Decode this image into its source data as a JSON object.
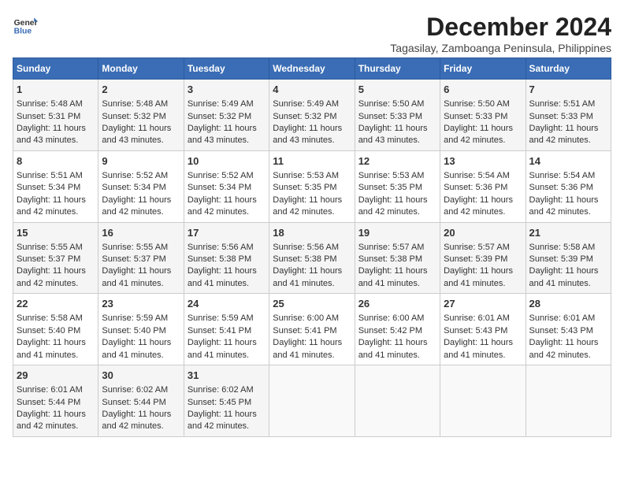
{
  "header": {
    "logo_line1": "General",
    "logo_line2": "Blue",
    "title": "December 2024",
    "subtitle": "Tagasilay, Zamboanga Peninsula, Philippines"
  },
  "days_of_week": [
    "Sunday",
    "Monday",
    "Tuesday",
    "Wednesday",
    "Thursday",
    "Friday",
    "Saturday"
  ],
  "weeks": [
    [
      {
        "day": "1",
        "lines": [
          "Sunrise: 5:48 AM",
          "Sunset: 5:31 PM",
          "Daylight: 11 hours",
          "and 43 minutes."
        ]
      },
      {
        "day": "2",
        "lines": [
          "Sunrise: 5:48 AM",
          "Sunset: 5:32 PM",
          "Daylight: 11 hours",
          "and 43 minutes."
        ]
      },
      {
        "day": "3",
        "lines": [
          "Sunrise: 5:49 AM",
          "Sunset: 5:32 PM",
          "Daylight: 11 hours",
          "and 43 minutes."
        ]
      },
      {
        "day": "4",
        "lines": [
          "Sunrise: 5:49 AM",
          "Sunset: 5:32 PM",
          "Daylight: 11 hours",
          "and 43 minutes."
        ]
      },
      {
        "day": "5",
        "lines": [
          "Sunrise: 5:50 AM",
          "Sunset: 5:33 PM",
          "Daylight: 11 hours",
          "and 43 minutes."
        ]
      },
      {
        "day": "6",
        "lines": [
          "Sunrise: 5:50 AM",
          "Sunset: 5:33 PM",
          "Daylight: 11 hours",
          "and 42 minutes."
        ]
      },
      {
        "day": "7",
        "lines": [
          "Sunrise: 5:51 AM",
          "Sunset: 5:33 PM",
          "Daylight: 11 hours",
          "and 42 minutes."
        ]
      }
    ],
    [
      {
        "day": "8",
        "lines": [
          "Sunrise: 5:51 AM",
          "Sunset: 5:34 PM",
          "Daylight: 11 hours",
          "and 42 minutes."
        ]
      },
      {
        "day": "9",
        "lines": [
          "Sunrise: 5:52 AM",
          "Sunset: 5:34 PM",
          "Daylight: 11 hours",
          "and 42 minutes."
        ]
      },
      {
        "day": "10",
        "lines": [
          "Sunrise: 5:52 AM",
          "Sunset: 5:34 PM",
          "Daylight: 11 hours",
          "and 42 minutes."
        ]
      },
      {
        "day": "11",
        "lines": [
          "Sunrise: 5:53 AM",
          "Sunset: 5:35 PM",
          "Daylight: 11 hours",
          "and 42 minutes."
        ]
      },
      {
        "day": "12",
        "lines": [
          "Sunrise: 5:53 AM",
          "Sunset: 5:35 PM",
          "Daylight: 11 hours",
          "and 42 minutes."
        ]
      },
      {
        "day": "13",
        "lines": [
          "Sunrise: 5:54 AM",
          "Sunset: 5:36 PM",
          "Daylight: 11 hours",
          "and 42 minutes."
        ]
      },
      {
        "day": "14",
        "lines": [
          "Sunrise: 5:54 AM",
          "Sunset: 5:36 PM",
          "Daylight: 11 hours",
          "and 42 minutes."
        ]
      }
    ],
    [
      {
        "day": "15",
        "lines": [
          "Sunrise: 5:55 AM",
          "Sunset: 5:37 PM",
          "Daylight: 11 hours",
          "and 42 minutes."
        ]
      },
      {
        "day": "16",
        "lines": [
          "Sunrise: 5:55 AM",
          "Sunset: 5:37 PM",
          "Daylight: 11 hours",
          "and 41 minutes."
        ]
      },
      {
        "day": "17",
        "lines": [
          "Sunrise: 5:56 AM",
          "Sunset: 5:38 PM",
          "Daylight: 11 hours",
          "and 41 minutes."
        ]
      },
      {
        "day": "18",
        "lines": [
          "Sunrise: 5:56 AM",
          "Sunset: 5:38 PM",
          "Daylight: 11 hours",
          "and 41 minutes."
        ]
      },
      {
        "day": "19",
        "lines": [
          "Sunrise: 5:57 AM",
          "Sunset: 5:38 PM",
          "Daylight: 11 hours",
          "and 41 minutes."
        ]
      },
      {
        "day": "20",
        "lines": [
          "Sunrise: 5:57 AM",
          "Sunset: 5:39 PM",
          "Daylight: 11 hours",
          "and 41 minutes."
        ]
      },
      {
        "day": "21",
        "lines": [
          "Sunrise: 5:58 AM",
          "Sunset: 5:39 PM",
          "Daylight: 11 hours",
          "and 41 minutes."
        ]
      }
    ],
    [
      {
        "day": "22",
        "lines": [
          "Sunrise: 5:58 AM",
          "Sunset: 5:40 PM",
          "Daylight: 11 hours",
          "and 41 minutes."
        ]
      },
      {
        "day": "23",
        "lines": [
          "Sunrise: 5:59 AM",
          "Sunset: 5:40 PM",
          "Daylight: 11 hours",
          "and 41 minutes."
        ]
      },
      {
        "day": "24",
        "lines": [
          "Sunrise: 5:59 AM",
          "Sunset: 5:41 PM",
          "Daylight: 11 hours",
          "and 41 minutes."
        ]
      },
      {
        "day": "25",
        "lines": [
          "Sunrise: 6:00 AM",
          "Sunset: 5:41 PM",
          "Daylight: 11 hours",
          "and 41 minutes."
        ]
      },
      {
        "day": "26",
        "lines": [
          "Sunrise: 6:00 AM",
          "Sunset: 5:42 PM",
          "Daylight: 11 hours",
          "and 41 minutes."
        ]
      },
      {
        "day": "27",
        "lines": [
          "Sunrise: 6:01 AM",
          "Sunset: 5:43 PM",
          "Daylight: 11 hours",
          "and 41 minutes."
        ]
      },
      {
        "day": "28",
        "lines": [
          "Sunrise: 6:01 AM",
          "Sunset: 5:43 PM",
          "Daylight: 11 hours",
          "and 42 minutes."
        ]
      }
    ],
    [
      {
        "day": "29",
        "lines": [
          "Sunrise: 6:01 AM",
          "Sunset: 5:44 PM",
          "Daylight: 11 hours",
          "and 42 minutes."
        ]
      },
      {
        "day": "30",
        "lines": [
          "Sunrise: 6:02 AM",
          "Sunset: 5:44 PM",
          "Daylight: 11 hours",
          "and 42 minutes."
        ]
      },
      {
        "day": "31",
        "lines": [
          "Sunrise: 6:02 AM",
          "Sunset: 5:45 PM",
          "Daylight: 11 hours",
          "and 42 minutes."
        ]
      },
      {
        "day": "",
        "lines": []
      },
      {
        "day": "",
        "lines": []
      },
      {
        "day": "",
        "lines": []
      },
      {
        "day": "",
        "lines": []
      }
    ]
  ]
}
